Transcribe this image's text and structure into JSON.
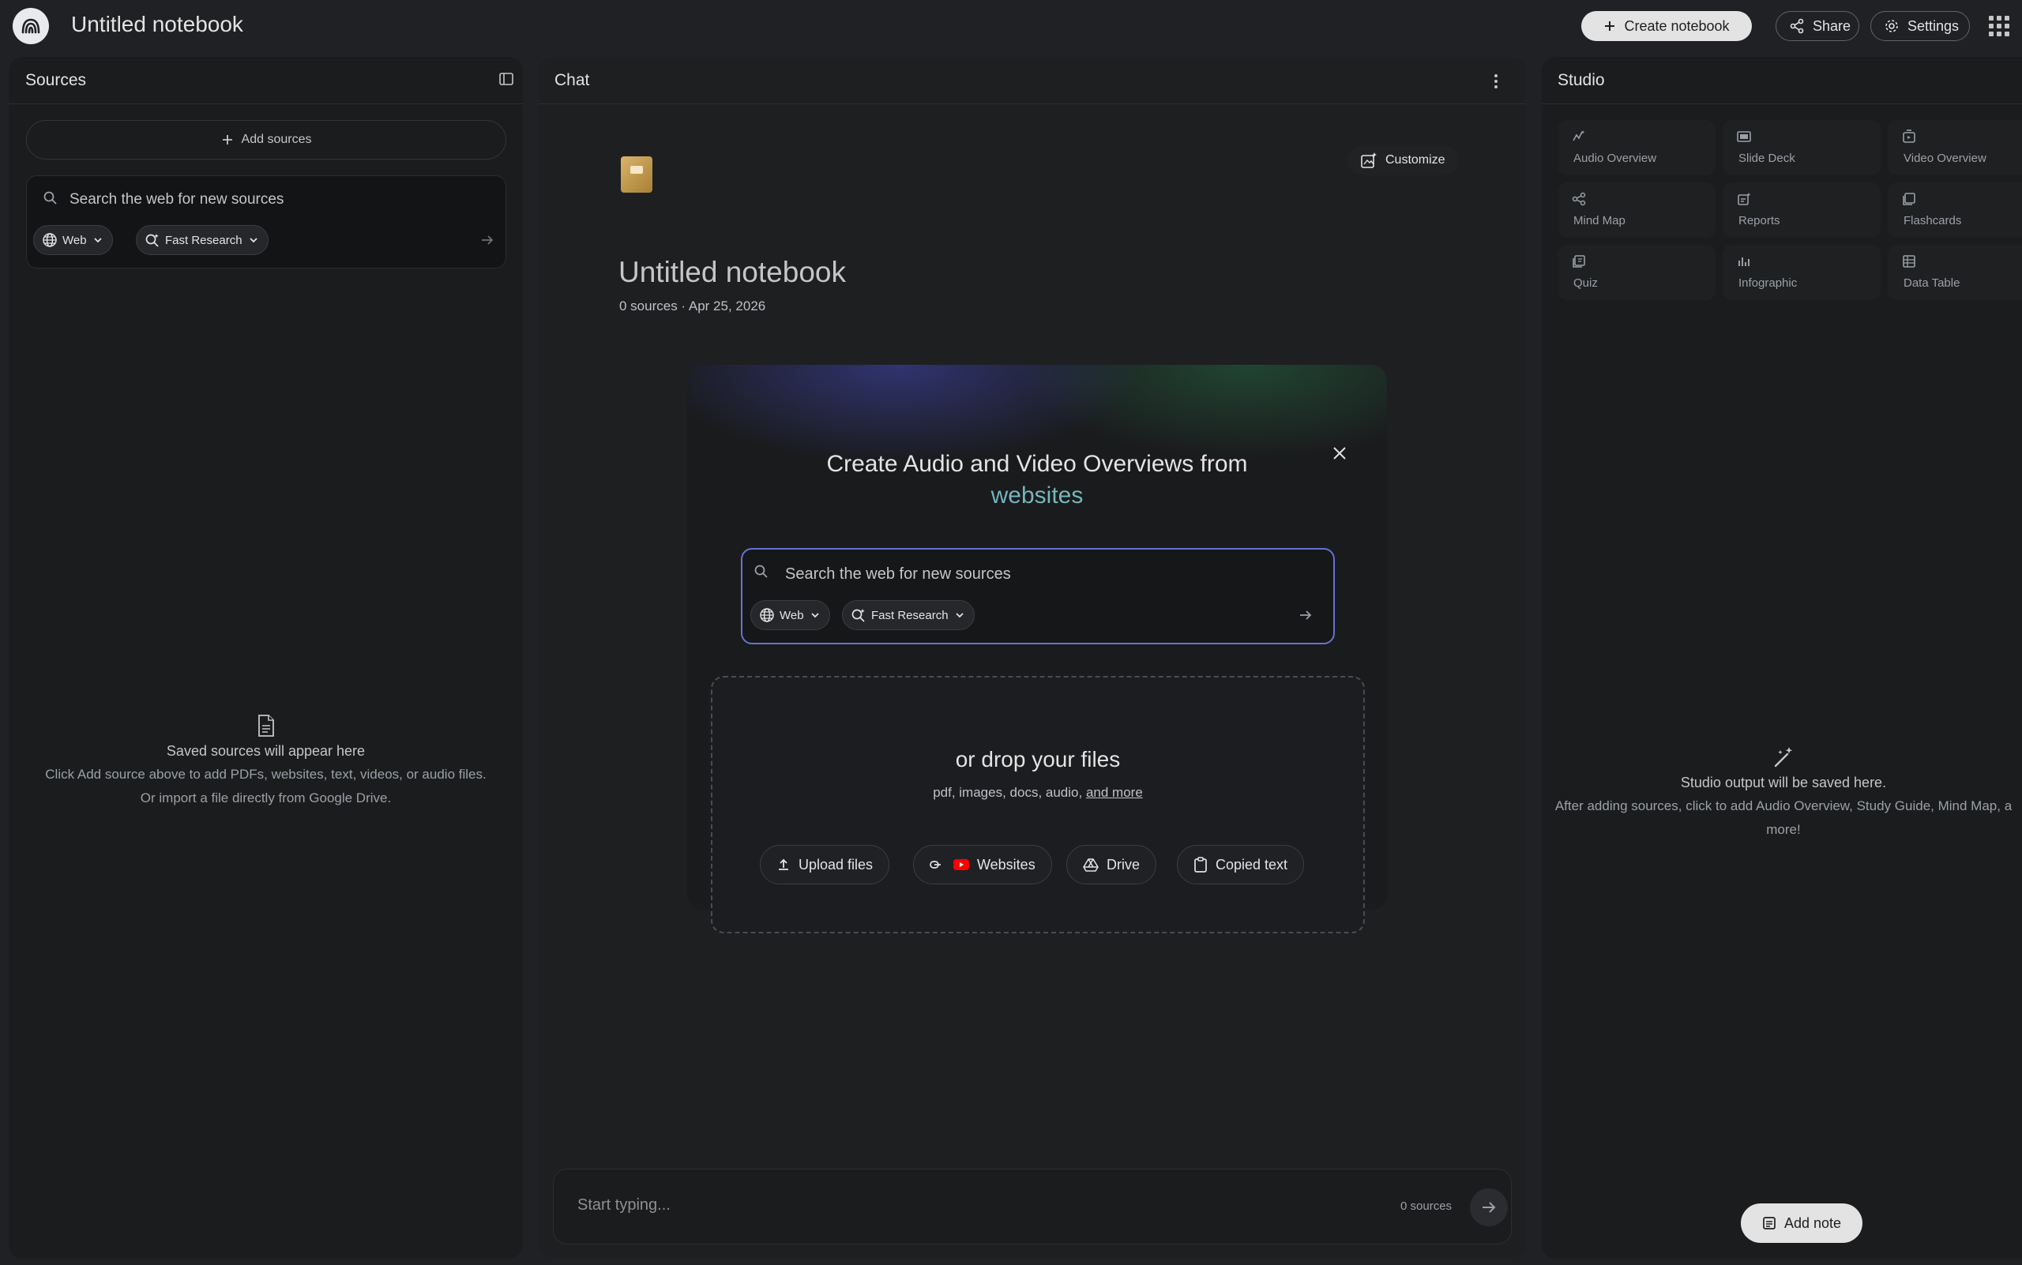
{
  "app": {
    "notebook_title": "Untitled notebook",
    "create_notebook": "Create notebook",
    "share": "Share",
    "settings": "Settings",
    "icons": {
      "logo": "notebooklm-logo-icon",
      "apps": "apps-grid-icon"
    }
  },
  "sources": {
    "title": "Sources",
    "add_sources": "Add sources",
    "search_placeholder": "Search the web for new sources",
    "web_chip": "Web",
    "research_chip": "Fast Research",
    "empty_title": "Saved sources will appear here",
    "empty_line1": "Click Add source above to add PDFs, websites, text, videos, or audio files.",
    "empty_line2": "Or import a file directly from Google Drive."
  },
  "chat": {
    "title": "Chat",
    "customize": "Customize",
    "notebook_title": "Untitled notebook",
    "subtitle": "0 sources · Apr 25, 2026",
    "overview": {
      "title_line1": "Create Audio and Video Overviews from",
      "title_accent": "websites",
      "search_placeholder": "Search the web for new sources",
      "web_chip": "Web",
      "research_chip": "Fast Research"
    },
    "drop": {
      "title": "or drop your files",
      "subtitle": "pdf, images, docs, audio,",
      "more_link": "and more",
      "buttons": [
        "Upload files",
        "Websites",
        "Drive",
        "Copied text"
      ]
    },
    "composer_placeholder": "Start typing...",
    "composer_count": "0 sources"
  },
  "studio": {
    "title": "Studio",
    "tiles": [
      "Audio Overview",
      "Slide Deck",
      "Video Overview",
      "Mind Map",
      "Reports",
      "Flashcards",
      "Quiz",
      "Infographic",
      "Data Table"
    ],
    "empty_title": "Studio output will be saved here.",
    "empty_line1": "After adding sources, click to add Audio Overview, Study Guide, Mind Map, a",
    "empty_line2": "more!",
    "add_note": "Add note"
  },
  "colors": {
    "background": "#202124",
    "panel": "#1b1c1e",
    "accent_focus": "#6671d6",
    "accent_gradient_start": "#6f9cf0",
    "accent_gradient_end": "#7fd08a"
  }
}
